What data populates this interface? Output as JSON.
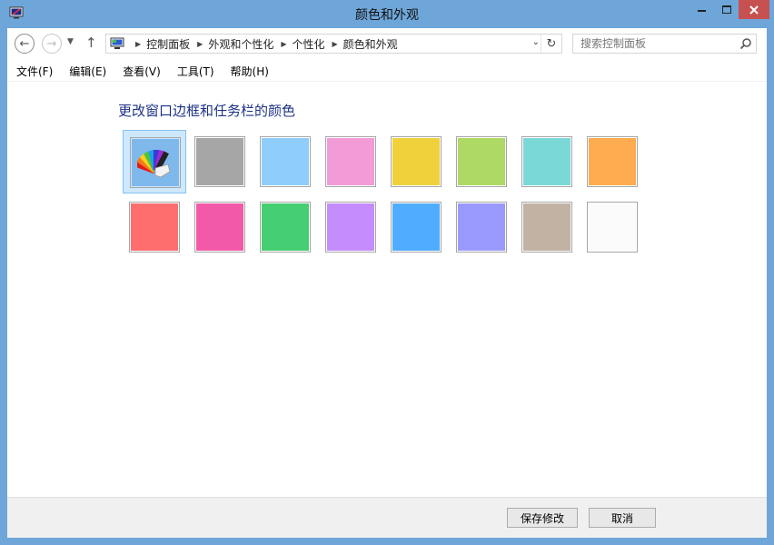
{
  "window": {
    "title": "颜色和外观",
    "app_icon": "personalization-monitor-icon"
  },
  "navigation": {
    "back_icon": "arrow-left-icon",
    "forward_icon": "arrow-right-icon",
    "recent_icon": "chevron-down-icon",
    "up_icon": "arrow-up-icon"
  },
  "address": {
    "breadcrumbs": [
      "控制面板",
      "外观和个性化",
      "个性化",
      "颜色和外观"
    ]
  },
  "search": {
    "placeholder": "搜索控制面板"
  },
  "menu": {
    "items": [
      "文件(F)",
      "编辑(E)",
      "查看(V)",
      "工具(T)",
      "帮助(H)"
    ]
  },
  "main": {
    "heading": "更改窗口边框和任务栏的颜色",
    "palette_icon": "color-palette-icon",
    "colors": [
      {
        "name": "automatic",
        "hex": "#7fb9ec"
      },
      {
        "name": "gray",
        "hex": "#a6a6a6"
      },
      {
        "name": "sky-blue",
        "hex": "#8ecdfc"
      },
      {
        "name": "pink",
        "hex": "#f29bd7"
      },
      {
        "name": "yellow",
        "hex": "#f0d13c"
      },
      {
        "name": "lime",
        "hex": "#aed964"
      },
      {
        "name": "teal",
        "hex": "#7ad9d7"
      },
      {
        "name": "orange",
        "hex": "#ffab4f"
      },
      {
        "name": "red",
        "hex": "#ff6e6e"
      },
      {
        "name": "magenta",
        "hex": "#f25aa8"
      },
      {
        "name": "green",
        "hex": "#45cf72"
      },
      {
        "name": "violet",
        "hex": "#c48cfd"
      },
      {
        "name": "blue",
        "hex": "#50acfe"
      },
      {
        "name": "periwinkle",
        "hex": "#9a9afe"
      },
      {
        "name": "taupe",
        "hex": "#c2b2a4"
      },
      {
        "name": "white",
        "hex": "#fbfbfb"
      }
    ]
  },
  "footer": {
    "save_label": "保存修改",
    "cancel_label": "取消"
  }
}
